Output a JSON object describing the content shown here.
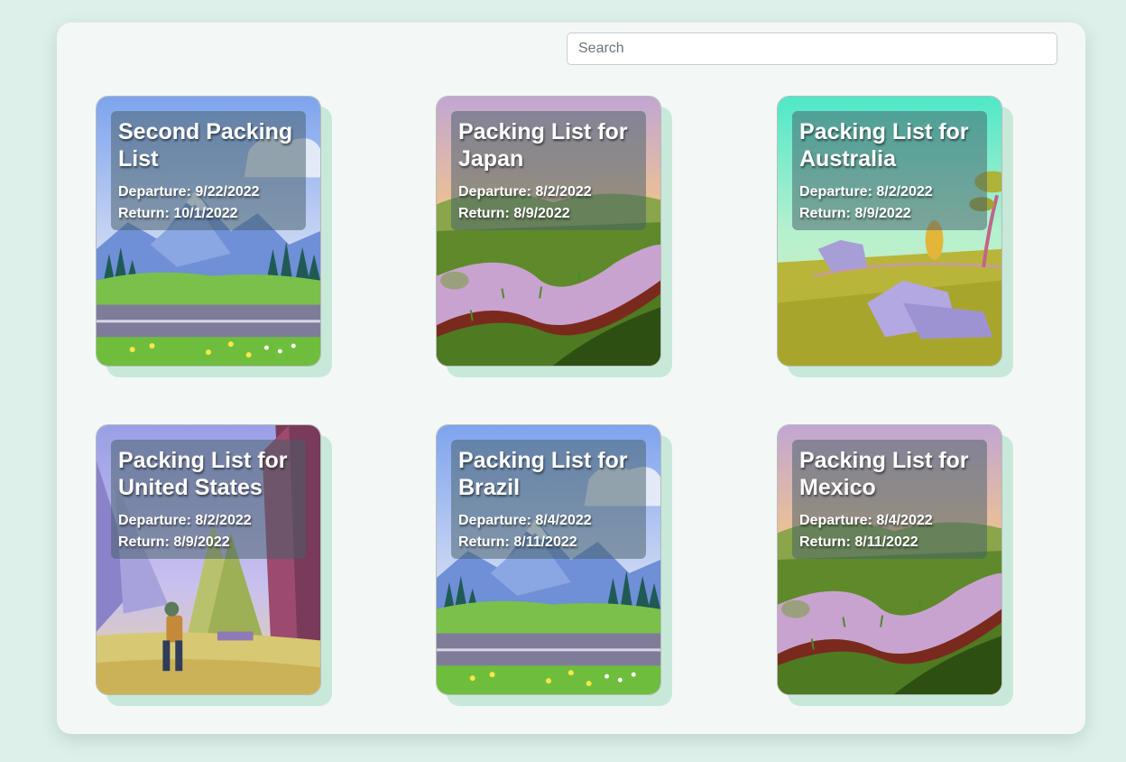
{
  "search": {
    "placeholder": "Search",
    "value": ""
  },
  "date_labels": {
    "departure": "Departure:",
    "return": "Return:"
  },
  "cards": [
    {
      "title": "Second Packing List",
      "departure": "9/22/2022",
      "return": "10/1/2022",
      "scene": "mountain-road"
    },
    {
      "title": "Packing List for Japan",
      "departure": "8/2/2022",
      "return": "8/9/2022",
      "scene": "rice-terrace"
    },
    {
      "title": "Packing List for Australia",
      "departure": "8/2/2022",
      "return": "8/9/2022",
      "scene": "savanna-rocks"
    },
    {
      "title": "Packing List for United States",
      "departure": "8/2/2022",
      "return": "8/9/2022",
      "scene": "forest-hiker"
    },
    {
      "title": "Packing List for Brazil",
      "departure": "8/4/2022",
      "return": "8/11/2022",
      "scene": "mountain-road"
    },
    {
      "title": "Packing List for Mexico",
      "departure": "8/4/2022",
      "return": "8/11/2022",
      "scene": "rice-terrace"
    }
  ]
}
